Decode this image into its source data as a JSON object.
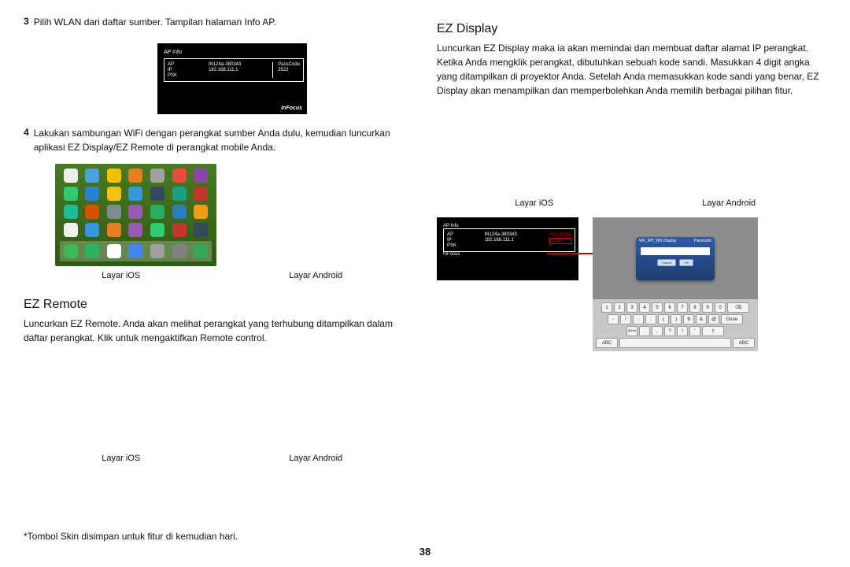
{
  "left": {
    "step3_num": "3",
    "step3_text": "Pilih WLAN  dari daftar sumber. Tampilan halaman Info AP.",
    "ap": {
      "title": "AP Info",
      "k1": "AP",
      "v1": "IN124a-380343",
      "k2": "IP",
      "v2": "192.168.111.1",
      "k3": "PSK",
      "v3": "",
      "pass_k": "PassCode",
      "pass_v": "3522",
      "brand": "InFocus"
    },
    "step4_num": "4",
    "step4_text": "Lakukan sambungan WiFi dengan perangkat sumber Anda dulu, kemudian luncurkan aplikasi EZ Display/EZ Remote di perangkat mobile Anda.",
    "cap_ios": "Layar iOS",
    "cap_android": "Layar Android",
    "h_remote": "EZ Remote",
    "p_remote": "Luncurkan EZ Remote. Anda akan melihat perangkat yang terhubung ditampilkan dalam daftar perangkat. Klik untuk mengaktifkan Remote control.",
    "cap2_ios": "Layar iOS",
    "cap2_android": "Layar Android",
    "footnote": "*Tombol Skin disimpan untuk fitur di kemudian hari."
  },
  "right": {
    "h_display": "EZ Display",
    "p_display": "Luncurkan EZ Display maka ia akan memindai dan membuat daftar alamat IP perangkat. Ketika Anda mengklik perangkat, dibutuhkan sebuah kode sandi. Masukkan 4 digit angka yang ditampilkan di proyektor Anda. Setelah Anda memasukkan kode sandi yang benar, EZ Display akan menampilkan dan memperbolehkan Anda memilih berbagai pilihan fitur.",
    "cap_ios": "Layar iOS",
    "cap_android": "Layar Android",
    "ap": {
      "title": "AP Info",
      "k1": "AP",
      "v1": "IN124a-380343",
      "k2": "IP",
      "v2": "192.168.111.1",
      "k3": "PSK",
      "v3": "",
      "pass_k": "PassCode",
      "pass_v": "3522",
      "brand": "InFocus"
    },
    "dialog": {
      "name": "WF_IPP_WS Display",
      "label": "Passcode",
      "cancel": "Cancel",
      "ok": "OK"
    },
    "keys": {
      "r1": [
        "1",
        "2",
        "3",
        "4",
        "5",
        "6",
        "7",
        "8",
        "9",
        "0",
        "⌫"
      ],
      "r2": [
        "-",
        "/",
        ":",
        ";",
        "(",
        ")",
        "$",
        "&",
        "@",
        "Done"
      ],
      "r3": [
        "#+=",
        ".",
        ",",
        "?",
        "!",
        "'",
        "⇧"
      ],
      "r4": [
        "ABC",
        "",
        "ABC"
      ]
    }
  },
  "pagenum": "38",
  "ios_icon_colors": [
    [
      "#eee",
      "#4aa3df",
      "#f2c200",
      "#e67e22",
      "#a0a0a0",
      "#e84c3d",
      "#8e44ad"
    ],
    [
      "#2ecc71",
      "#2c82c9",
      "#f1c40f",
      "#3498db",
      "#34495e",
      "#16a085",
      "#c0392b"
    ],
    [
      "#1abc9c",
      "#d35400",
      "#7f8c8d",
      "#9b59b6",
      "#27ae60",
      "#2980b9",
      "#f39c12"
    ],
    [
      "#ecf0f1",
      "#3498db",
      "#e67e22",
      "#9a59b5",
      "#2ecc71",
      "#c0392b",
      "#34495e"
    ]
  ],
  "ios_dock_colors": [
    "#3cba54",
    "#28b463",
    "#ffffff",
    "#4285f4",
    "#a0a0a0",
    "#808080",
    "#34a853"
  ]
}
